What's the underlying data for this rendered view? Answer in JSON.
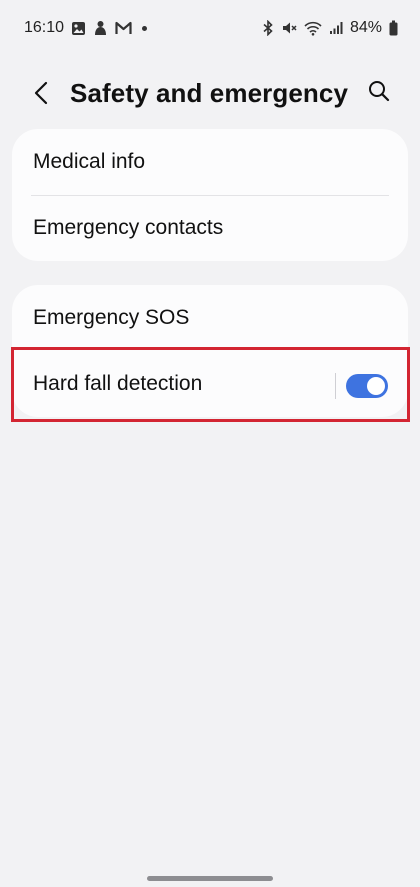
{
  "status_bar": {
    "time": "16:10",
    "battery": "84%",
    "left_icons": [
      "gallery-icon",
      "app-notification-icon",
      "gmail-icon"
    ],
    "right_icons": [
      "bluetooth-icon",
      "mute-icon",
      "wifi-icon",
      "signal-icon",
      "battery-icon"
    ]
  },
  "header": {
    "title": "Safety and emergency",
    "back_icon": "back-arrow-icon",
    "search_icon": "search-icon"
  },
  "group_1": {
    "items": [
      {
        "label": "Medical info"
      },
      {
        "label": "Emergency contacts"
      }
    ]
  },
  "group_2": {
    "items": [
      {
        "label": "Emergency SOS"
      },
      {
        "label": "Hard fall detection",
        "toggle": true
      }
    ]
  },
  "colors": {
    "accent": "#3e73e0",
    "background": "#f2f2f4",
    "card": "#fcfcfd",
    "highlight": "#d32532"
  }
}
